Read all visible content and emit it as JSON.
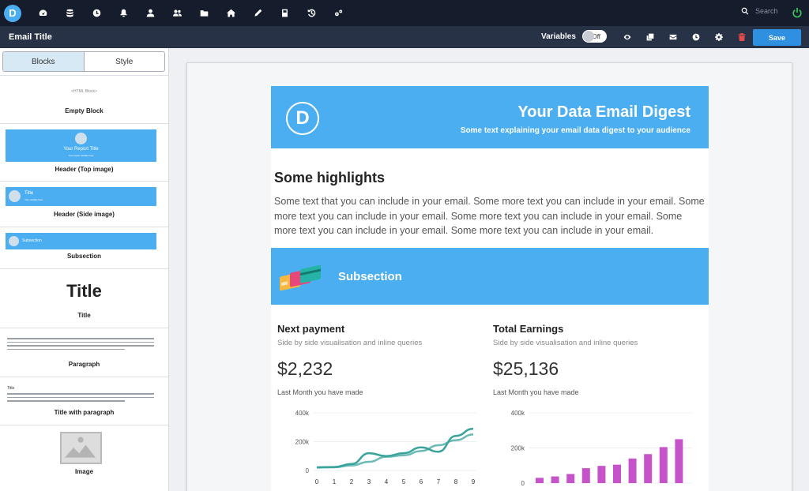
{
  "app": {
    "logo_letter": "D",
    "nav_icons": [
      "dashboard-icon",
      "database-icon",
      "clock-icon",
      "bell-icon",
      "user-icon",
      "users-icon",
      "folder-icon",
      "home-icon",
      "pencil-icon",
      "book-icon",
      "history-icon",
      "cogs-icon"
    ],
    "search_placeholder": "Search"
  },
  "toolbar": {
    "title": "Email Title",
    "variables_label": "Variables",
    "toggle_label": "Off",
    "icons": [
      "eye-icon",
      "copy-icon",
      "envelope-icon",
      "clock-icon",
      "gear-icon",
      "trash-icon"
    ],
    "save_label": "Save",
    "trash_color": "#e04a4a",
    "accent": "#2f8fe0"
  },
  "sidebar": {
    "tabs": [
      "Blocks",
      "Style"
    ],
    "blocks": {
      "empty": {
        "preview": "<HTML Block>",
        "label": "Empty Block"
      },
      "header_top": {
        "preview_title": "Your Report Title",
        "preview_sub": "Your report subtitle here",
        "label": "Header (Top image)"
      },
      "header_side": {
        "preview_title": "Title",
        "preview_sub": "Your subtitle here",
        "label": "Header (Side image)"
      },
      "subsection": {
        "preview_title": "Subsection",
        "label": "Subsection"
      },
      "title": {
        "preview": "Title",
        "label": "Title"
      },
      "paragraph": {
        "label": "Paragraph"
      },
      "title_para": {
        "preview_title": "Title",
        "label": "Title with paragraph"
      },
      "image": {
        "label": "Image"
      }
    }
  },
  "email": {
    "logo_letter": "D",
    "title": "Your Data Email Digest",
    "subtitle": "Some text explaining your email data digest to your audience",
    "highlights_title": "Some highlights",
    "highlights_text": "Some text that you can include in your email. Some more text you can include in your email. Some more text you can include in your email. Some more text you can include in your email. Some more text you can include in your email. Some more text you can include in your email.",
    "subsection_title": "Subsection",
    "brand_color": "#4aaef0",
    "cards": [
      {
        "title": "Next payment",
        "desc": "Side by side visualisation and inline queries",
        "value": "$2,232",
        "note": "Last Month you have made"
      },
      {
        "title": "Total Earnings",
        "desc": "Side by side visualisation and inline queries",
        "value": "$25,136",
        "note": "Last Month you have made"
      }
    ]
  },
  "chart_data": [
    {
      "type": "line",
      "x": [
        0,
        1,
        2,
        3,
        4,
        5,
        6,
        7,
        8,
        9
      ],
      "y_ticks": [
        "400k",
        "200k",
        "0"
      ],
      "ylim": [
        0,
        400000
      ],
      "color": "#3aa39b",
      "series": [
        {
          "values": [
            20000,
            22000,
            35000,
            60000,
            95000,
            105000,
            135000,
            175000,
            210000,
            250000
          ]
        },
        {
          "values": [
            22000,
            24000,
            45000,
            120000,
            100000,
            120000,
            160000,
            130000,
            240000,
            290000
          ]
        }
      ]
    },
    {
      "type": "bar",
      "y_ticks": [
        "400k",
        "200k",
        "0"
      ],
      "ylim": [
        0,
        400000
      ],
      "color": "#c653c9",
      "values": [
        30000,
        38000,
        52000,
        85000,
        98000,
        105000,
        140000,
        165000,
        205000,
        250000
      ]
    }
  ]
}
